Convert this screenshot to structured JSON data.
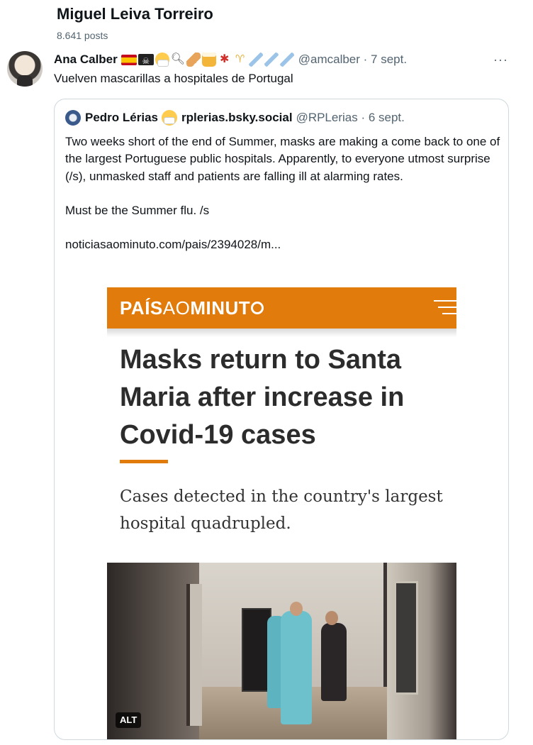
{
  "header": {
    "profile_name": "Miguel Leiva Torreiro",
    "post_count": "8.641 posts"
  },
  "tweet": {
    "author_name": "Ana Calber",
    "handle_time": "@amcalber · 7 sept.",
    "more_label": "···",
    "text": "Vuelven mascarillas a hospitales de Portugal",
    "emoji_icons": [
      "spain-flag-icon",
      "pirate-flag-icon",
      "mask-face-icon",
      "magnifier-icon",
      "bandage-icon",
      "beer-icon",
      "lobster-icon",
      "champagne-icon",
      "syringe-icon",
      "syringe-icon",
      "syringe-icon"
    ]
  },
  "quote": {
    "author_name": "Pedro Lérias",
    "display_handle": "rplerias.bsky.social",
    "handle_time": "@RPLerias · 6 sept.",
    "paragraph1": "Two weeks short of the end of Summer, masks are making a come back to one of the largest Portuguese public hospitals. Apparently, to everyone utmost surprise (/s), unmasked staff and patients are falling ill at alarming rates.",
    "paragraph2": "Must be the Summer flu. /s",
    "link": "noticiasaominuto.com/pais/2394028/m..."
  },
  "article": {
    "brand_bold1": "PAÍS",
    "brand_light": "AO",
    "brand_bold2": "MINUT",
    "brand_color": "#e07b0c",
    "headline": "Masks return to Santa Maria after increase in Covid-19 cases",
    "subheadline": "Cases detected in the country's largest hospital quadrupled.",
    "alt_label": "ALT"
  }
}
